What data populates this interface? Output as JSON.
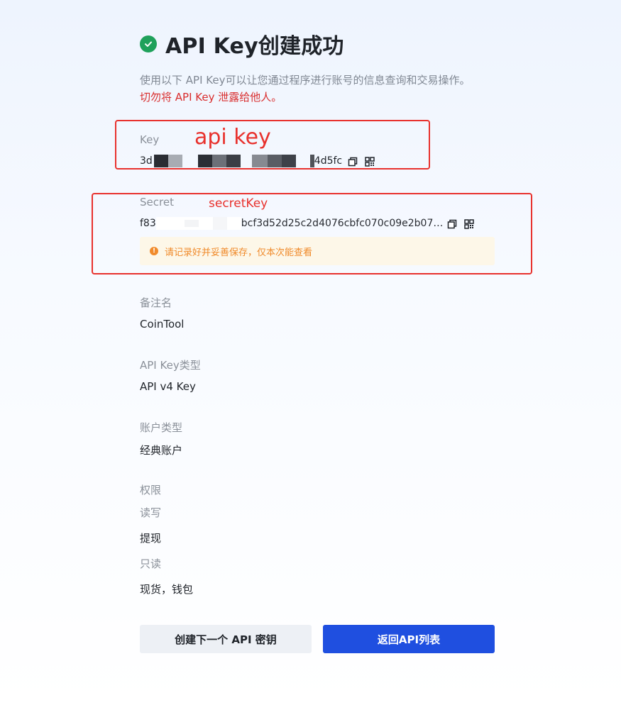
{
  "header": {
    "title": "API Key创建成功",
    "description": "使用以下 API Key可以让您通过程序进行账号的信息查询和交易操作。",
    "warning": "切勿将 API Key 泄露给他人。"
  },
  "key_section": {
    "label": "Key",
    "value_prefix": "3d",
    "value_suffix": "4d5fc",
    "annotation": "api key"
  },
  "secret_section": {
    "label": "Secret",
    "value_prefix": "f83",
    "value_suffix": "bcf3d52d25c2d4076cbfc070c09e2b07…",
    "annotation": "secretKey",
    "notice": "请记录好并妥善保存，仅本次能查看"
  },
  "fields": {
    "remark_label": "备注名",
    "remark_value": "CoinTool",
    "type_label": "API Key类型",
    "type_value": "API v4 Key",
    "account_label": "账户类型",
    "account_value": "经典账户",
    "permission_label": "权限",
    "readwrite_label": "读写",
    "readwrite_value": "提现",
    "readonly_label": "只读",
    "readonly_value": "现货，钱包"
  },
  "buttons": {
    "create_next": "创建下一个 API 密钥",
    "back_to_list": "返回API列表"
  },
  "colors": {
    "success": "#1fa15b",
    "danger": "#d92d2d",
    "annotation_red": "#e8312d",
    "primary": "#1f4fe0",
    "notice_text": "#f08a2a"
  },
  "icons": {
    "status": "check-circle-icon",
    "copy": "copy-icon",
    "qr": "qr-code-icon",
    "notice": "info-icon"
  }
}
